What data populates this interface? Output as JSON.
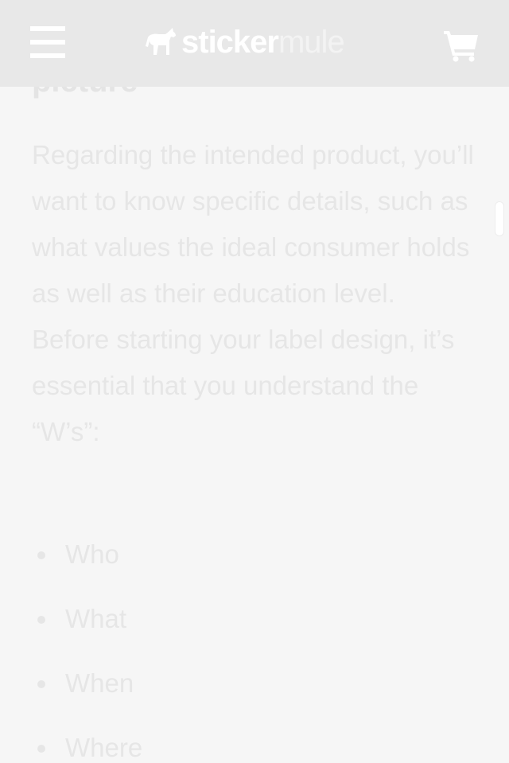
{
  "header": {
    "logo": {
      "part1": "sticker",
      "part2": "mule",
      "mark_icon": "mule-icon"
    },
    "menu_icon": "hamburger-menu-icon",
    "cart_icon": "shopping-cart-icon"
  },
  "article": {
    "heading_fragment": "picture",
    "paragraph": "Regarding the intended product, you’ll want to know specific details, such as what values the ideal consumer holds as well as their education level. Before starting your label design, it’s essential that you understand the “W’s”:",
    "list": [
      "Who",
      "What",
      "When",
      "Where"
    ]
  },
  "colors": {
    "header_bg": "#e8e8e8",
    "page_bg": "#f6f6f6",
    "text": "#e6e6e6",
    "white": "#ffffff"
  }
}
